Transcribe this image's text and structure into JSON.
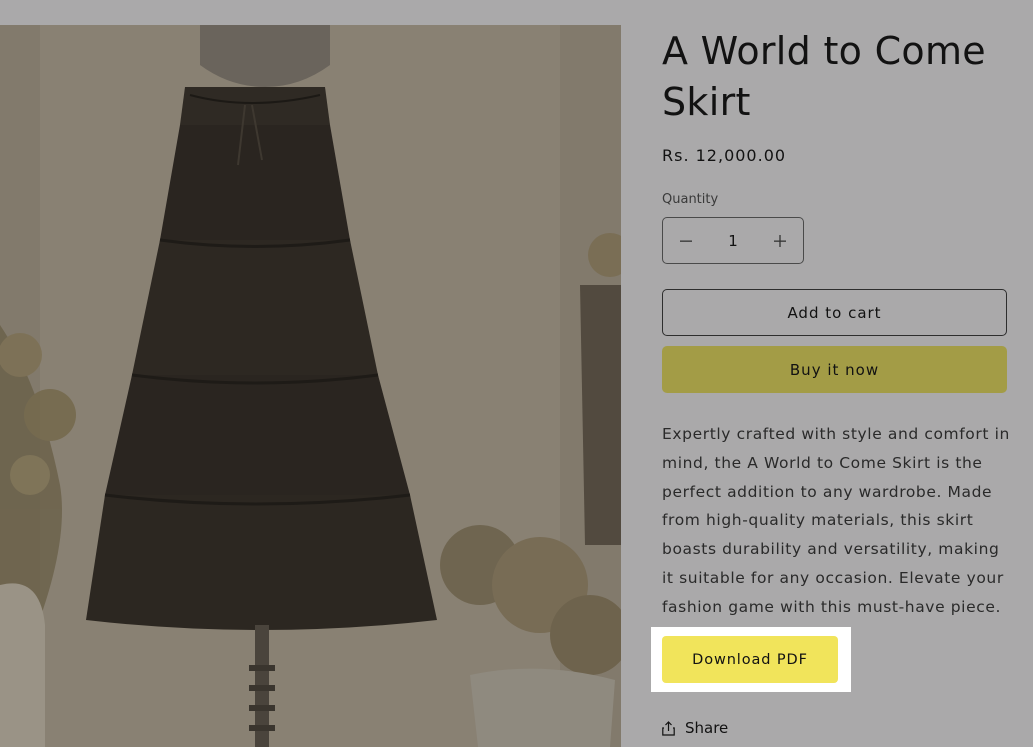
{
  "product": {
    "title": "A World to Come Skirt",
    "price": "Rs. 12,000.00",
    "image_alt": "Black tiered skirt on a dress form"
  },
  "quantity": {
    "label": "Quantity",
    "value": "1",
    "decrease_icon": "minus-icon",
    "increase_icon": "plus-icon"
  },
  "actions": {
    "add_to_cart": "Add to cart",
    "buy_now": "Buy it now",
    "download_pdf": "Download PDF",
    "share": "Share",
    "share_icon": "share-icon"
  },
  "description": "Expertly crafted with style and comfort in mind, the A World to Come Skirt is the perfect addition to any wardrobe. Made from high-quality materials, this skirt boasts durability and versatility, making it suitable for any occasion. Elevate your fashion game with this must-have piece.",
  "colors": {
    "page_overlay": "#aaa9aa",
    "buy_button": "#a39c46",
    "pdf_button": "#f1e45b",
    "highlight": "#ffffff"
  }
}
